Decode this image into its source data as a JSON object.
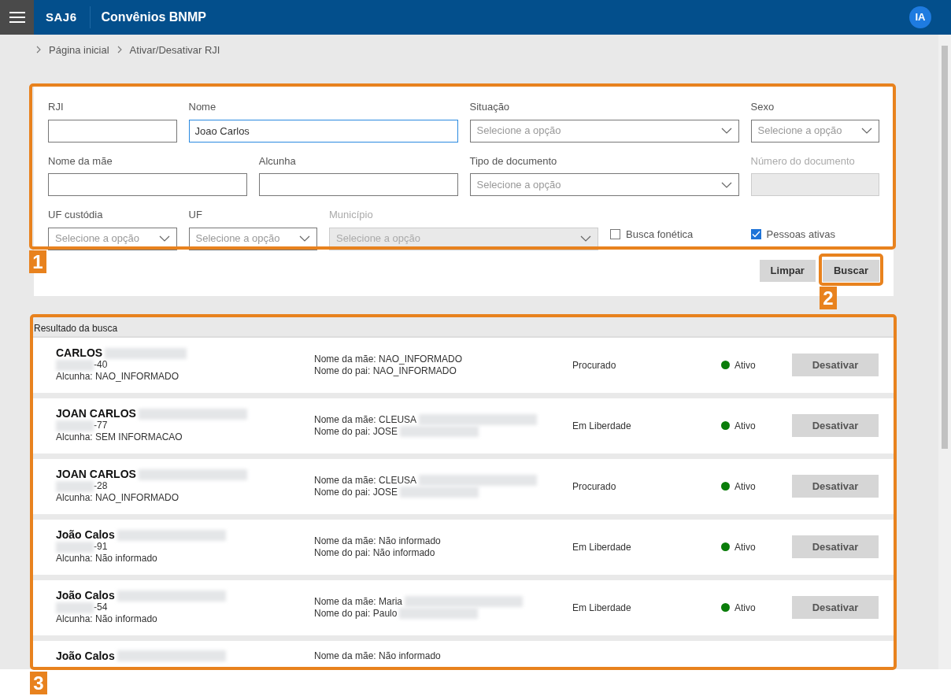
{
  "header": {
    "logo": "SAJ6",
    "title": "Convênios BNMP",
    "avatar": "IA"
  },
  "breadcrumb": [
    {
      "label": "Página inicial"
    },
    {
      "label": "Ativar/Desativar RJI"
    }
  ],
  "form": {
    "rows": [
      [
        {
          "label": "RJI",
          "kind": "text",
          "disabled": false,
          "focused": false
        },
        {
          "label": "Nome",
          "kind": "text",
          "value": "Joao Carlos",
          "disabled": false,
          "focused": true
        },
        {
          "label": "Situação",
          "kind": "select",
          "placeholder": "Selecione a opção",
          "disabled": false
        },
        {
          "label": "Sexo",
          "kind": "select",
          "placeholder": "Selecione a opção",
          "disabled": false
        }
      ],
      [
        {
          "label": "Nome da mãe",
          "kind": "text",
          "disabled": false,
          "focused": false
        },
        {
          "label": "Alcunha",
          "kind": "text",
          "disabled": false,
          "focused": false
        },
        {
          "label": "Tipo de documento",
          "kind": "select",
          "placeholder": "Selecione a opção",
          "disabled": false
        },
        {
          "label": "Número do documento",
          "kind": "text",
          "disabled": true,
          "focused": false
        }
      ],
      [
        {
          "label": "UF custódia",
          "kind": "select",
          "placeholder": "Selecione a opção",
          "disabled": false
        },
        {
          "label": "UF",
          "kind": "select",
          "placeholder": "Selecione a opção",
          "disabled": false
        },
        {
          "label": "Município",
          "kind": "select",
          "placeholder": "Selecione a opção",
          "disabled": true
        },
        {
          "label": "Busca fonética",
          "kind": "checkbox",
          "checked": false
        },
        {
          "label": "Pessoas ativas",
          "kind": "checkbox",
          "checked": true
        }
      ]
    ],
    "buttons": [
      "Limpar",
      "Buscar"
    ]
  },
  "results": {
    "title": "Resultado da busca",
    "rows": [
      {
        "name": "CARLOS",
        "document": "-40",
        "alias": "Alcunha: NAO_INFORMADO",
        "mother": "Nome da mãe: NAO_INFORMADO",
        "mother_redacted": false,
        "father": "Nome do pai: NAO_INFORMADO",
        "father_redacted": false,
        "situation": "Procurado",
        "status": "Ativo",
        "color": "#0a7d0a",
        "button": "Desativar"
      },
      {
        "name": "JOAN CARLOS",
        "document": "-77",
        "alias": "Alcunha: SEM INFORMACAO",
        "mother": "Nome da mãe: CLEUSA",
        "mother_redacted": true,
        "father": "Nome do pai: JOSE",
        "father_redacted": true,
        "situation": "Em Liberdade",
        "status": "Ativo",
        "color": "#0a7d0a",
        "button": "Desativar"
      },
      {
        "name": "JOAN CARLOS",
        "document": "-28",
        "alias": "Alcunha: NAO_INFORMADO",
        "mother": "Nome da mãe: CLEUSA",
        "mother_redacted": true,
        "father": "Nome do pai: JOSE",
        "father_redacted": true,
        "situation": "Procurado",
        "status": "Ativo",
        "color": "#0a7d0a",
        "button": "Desativar"
      },
      {
        "name": "João Calos",
        "document": "-91",
        "alias": "Alcunha: Não informado",
        "mother": "Nome da mãe: Não informado",
        "mother_redacted": false,
        "father": "Nome do pai: Não informado",
        "father_redacted": false,
        "situation": "Em Liberdade",
        "status": "Ativo",
        "color": "#0a7d0a",
        "button": "Desativar"
      },
      {
        "name": "João Calos",
        "document": "-54",
        "alias": "Alcunha: Não informado",
        "mother": "Nome da mãe: Maria",
        "mother_redacted": true,
        "father": "Nome do pai: Paulo",
        "father_redacted": true,
        "situation": "Em Liberdade",
        "status": "Ativo",
        "color": "#0a7d0a",
        "button": "Desativar"
      },
      {
        "name": "João Calos",
        "mother": "Nome da mãe: Não informado",
        "mother_redacted": false
      }
    ]
  },
  "annotations": [
    {
      "label": "1"
    },
    {
      "label": "2"
    },
    {
      "label": "3"
    }
  ]
}
